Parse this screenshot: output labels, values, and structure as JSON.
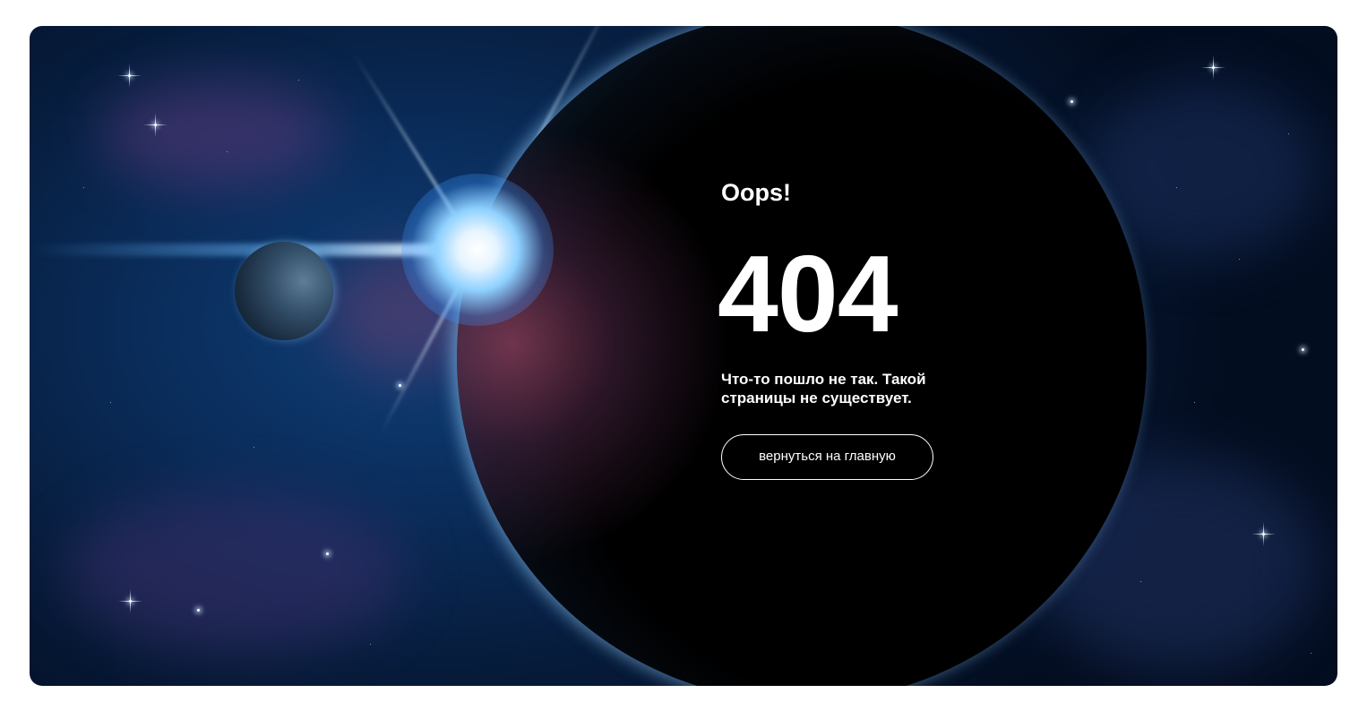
{
  "error_page": {
    "heading": "Oops!",
    "code": "404",
    "message": "Что-то пошло не так. Такой страницы не существует.",
    "home_button_label": "вернуться на главную"
  },
  "colors": {
    "page_background": "#ffffff",
    "text": "#ffffff",
    "button_border": "#ffffff",
    "space_background": "#0a2c5a"
  }
}
